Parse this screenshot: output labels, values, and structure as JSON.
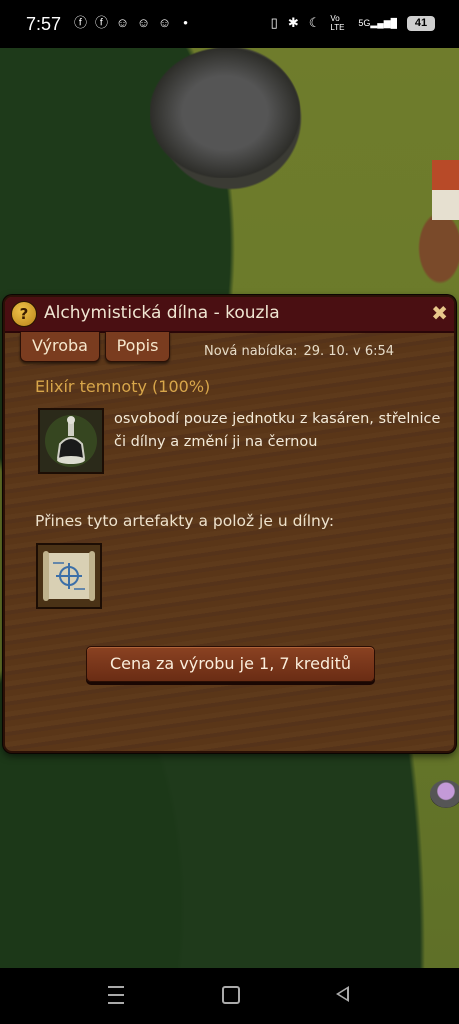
{
  "status_bar": {
    "time": "7:57",
    "battery": "41",
    "notification_icons": [
      "facebook-icon",
      "facebook-icon",
      "snapchat-icon",
      "snapchat-icon",
      "snapchat-icon",
      "dot-icon"
    ],
    "system_icons": [
      "vibrate-icon",
      "bluetooth-icon",
      "moon-icon",
      "volte-icon",
      "5g-signal-icon",
      "battery-icon"
    ],
    "volte_label": "Vo LTE",
    "signal_label": "5G"
  },
  "dialog": {
    "title": "Alchymistická dílna - kouzla",
    "help_symbol": "?",
    "close_symbol": "✖",
    "tabs": [
      {
        "label": "Výroba"
      },
      {
        "label": "Popis"
      }
    ],
    "offer_label": "Nová nabídka:",
    "offer_value": "29. 10.  v 6:54",
    "item_title": "Elixír temnoty (100%)",
    "item_description": "osvobodí pouze jednotku z kasáren, střelnice či dílny a změní ji na černou",
    "artifacts_label": "Přines tyto artefakty a polož je u dílny:",
    "price_button": "Cena za výrobu je 1, 7 kreditů"
  },
  "colors": {
    "title_bar": "#4a0f12",
    "panel": "#5a3618",
    "item_title": "#d8a64a",
    "button": "#7a3c1f"
  }
}
